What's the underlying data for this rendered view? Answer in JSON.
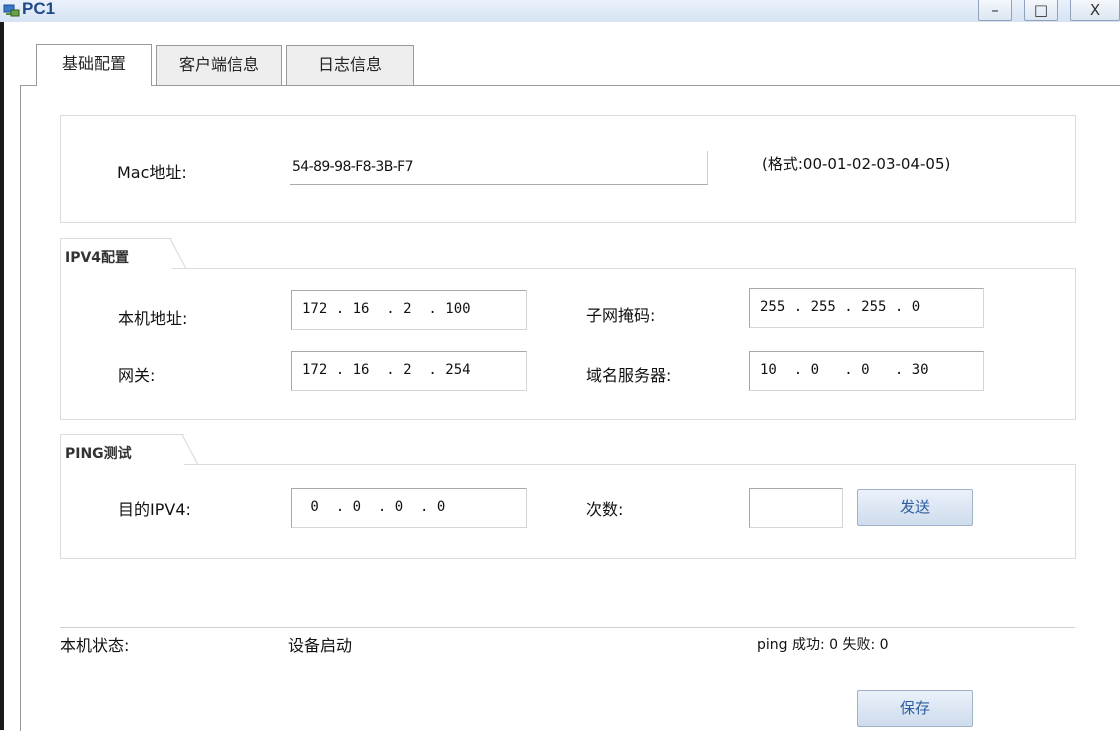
{
  "window": {
    "title": "PC1",
    "minimize": "–",
    "maximize": "□",
    "close": "X"
  },
  "tabs": [
    {
      "label": "基础配置",
      "active": true
    },
    {
      "label": "客户端信息",
      "active": false
    },
    {
      "label": "日志信息",
      "active": false
    }
  ],
  "mac": {
    "label": "Mac地址:",
    "value": "54-89-98-F8-3B-F7",
    "format_hint": "(格式:00-01-02-03-04-05)"
  },
  "ipv4": {
    "legend": "IPV4配置",
    "local_address_label": "本机地址:",
    "local_address": "172 . 16  . 2  . 100",
    "subnet_mask_label": "子网掩码:",
    "subnet_mask": "255 . 255 . 255 . 0",
    "gateway_label": "网关:",
    "gateway": "172 . 16  . 2  . 254",
    "dns_label": "域名服务器:",
    "dns": "10  . 0   . 0   . 30"
  },
  "ping": {
    "legend": "PING测试",
    "target_label": "目的IPV4:",
    "target": " 0  . 0  . 0  . 0",
    "count_label": "次数:",
    "count": "",
    "send_button": "发送"
  },
  "status": {
    "label": "本机状态:",
    "value": "设备启动",
    "ping_result": "ping 成功: 0 失败: 0"
  },
  "save_button": "保存",
  "colors": {
    "titlebar": "#d6e3f3",
    "title_text": "#1f4a8a",
    "button_text": "#2d5da0"
  }
}
